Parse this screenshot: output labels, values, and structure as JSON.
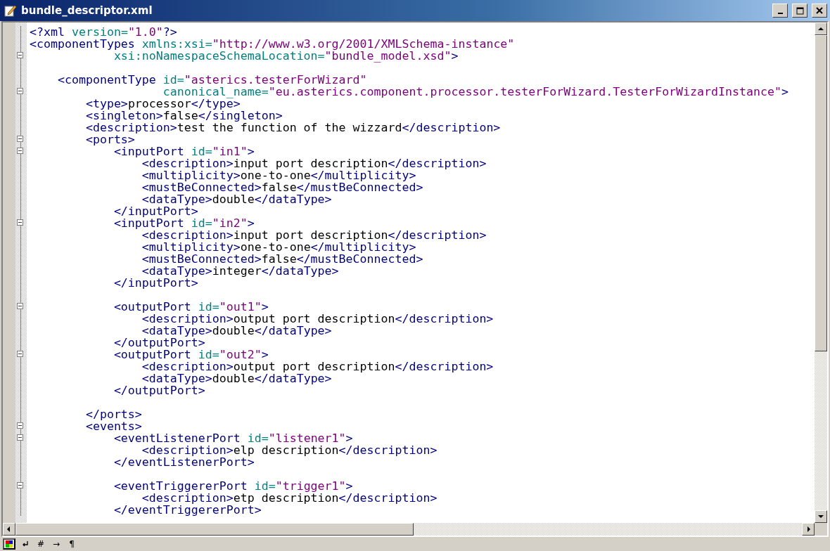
{
  "window": {
    "title": "bundle_descriptor.xml"
  },
  "editor": {
    "lines": [
      {
        "fold": false,
        "tokens": [
          {
            "kind": "tag",
            "text": "<?xml"
          },
          {
            "kind": "attr",
            "text": " version="
          },
          {
            "kind": "value",
            "text": "\"1.0\""
          },
          {
            "kind": "tag",
            "text": "?>"
          }
        ]
      },
      {
        "fold": false,
        "tokens": [
          {
            "kind": "tag",
            "text": "<componentTypes"
          },
          {
            "kind": "attr",
            "text": " xmlns:xsi="
          },
          {
            "kind": "value",
            "text": "\"http://www.w3.org/2001/XMLSchema-instance\""
          }
        ]
      },
      {
        "fold": true,
        "tokens": [
          {
            "kind": "attr",
            "text": "            xsi:noNamespaceSchemaLocation="
          },
          {
            "kind": "value",
            "text": "\"bundle_model.xsd\""
          },
          {
            "kind": "tag",
            "text": ">"
          }
        ]
      },
      {
        "fold": false
      },
      {
        "fold": false,
        "tokens": [
          {
            "kind": "tag",
            "text": "    <componentType"
          },
          {
            "kind": "attr",
            "text": " id="
          },
          {
            "kind": "value",
            "text": "\"asterics.testerForWizard\""
          }
        ]
      },
      {
        "fold": true,
        "tokens": [
          {
            "kind": "attr",
            "text": "                   canonical_name="
          },
          {
            "kind": "value",
            "text": "\"eu.asterics.component.processor.testerForWizard.TesterForWizardInstance\""
          },
          {
            "kind": "tag",
            "text": ">"
          }
        ]
      },
      {
        "fold": false,
        "tokens": [
          {
            "kind": "tag",
            "text": "        <type>"
          },
          {
            "kind": "text",
            "text": "processor"
          },
          {
            "kind": "tag",
            "text": "</type>"
          }
        ]
      },
      {
        "fold": false,
        "tokens": [
          {
            "kind": "tag",
            "text": "        <singleton>"
          },
          {
            "kind": "text",
            "text": "false"
          },
          {
            "kind": "tag",
            "text": "</singleton>"
          }
        ]
      },
      {
        "fold": false,
        "tokens": [
          {
            "kind": "tag",
            "text": "        <description>"
          },
          {
            "kind": "text",
            "text": "test the function of the wizzard"
          },
          {
            "kind": "tag",
            "text": "</description>"
          }
        ]
      },
      {
        "fold": true,
        "tokens": [
          {
            "kind": "tag",
            "text": "        <ports>"
          }
        ]
      },
      {
        "fold": true,
        "tokens": [
          {
            "kind": "tag",
            "text": "            <inputPort"
          },
          {
            "kind": "attr",
            "text": " id="
          },
          {
            "kind": "value",
            "text": "\"in1\""
          },
          {
            "kind": "tag",
            "text": ">"
          }
        ]
      },
      {
        "fold": false,
        "tokens": [
          {
            "kind": "tag",
            "text": "                <description>"
          },
          {
            "kind": "text",
            "text": "input port description"
          },
          {
            "kind": "tag",
            "text": "</description>"
          }
        ]
      },
      {
        "fold": false,
        "tokens": [
          {
            "kind": "tag",
            "text": "                <multiplicity>"
          },
          {
            "kind": "text",
            "text": "one-to-one"
          },
          {
            "kind": "tag",
            "text": "</multiplicity>"
          }
        ]
      },
      {
        "fold": false,
        "tokens": [
          {
            "kind": "tag",
            "text": "                <mustBeConnected>"
          },
          {
            "kind": "text",
            "text": "false"
          },
          {
            "kind": "tag",
            "text": "</mustBeConnected>"
          }
        ]
      },
      {
        "fold": false,
        "tokens": [
          {
            "kind": "tag",
            "text": "                <dataType>"
          },
          {
            "kind": "text",
            "text": "double"
          },
          {
            "kind": "tag",
            "text": "</dataType>"
          }
        ]
      },
      {
        "fold": false,
        "tokens": [
          {
            "kind": "tag",
            "text": "            </inputPort>"
          }
        ]
      },
      {
        "fold": true,
        "tokens": [
          {
            "kind": "tag",
            "text": "            <inputPort"
          },
          {
            "kind": "attr",
            "text": " id="
          },
          {
            "kind": "value",
            "text": "\"in2\""
          },
          {
            "kind": "tag",
            "text": ">"
          }
        ]
      },
      {
        "fold": false,
        "tokens": [
          {
            "kind": "tag",
            "text": "                <description>"
          },
          {
            "kind": "text",
            "text": "input port description"
          },
          {
            "kind": "tag",
            "text": "</description>"
          }
        ]
      },
      {
        "fold": false,
        "tokens": [
          {
            "kind": "tag",
            "text": "                <multiplicity>"
          },
          {
            "kind": "text",
            "text": "one-to-one"
          },
          {
            "kind": "tag",
            "text": "</multiplicity>"
          }
        ]
      },
      {
        "fold": false,
        "tokens": [
          {
            "kind": "tag",
            "text": "                <mustBeConnected>"
          },
          {
            "kind": "text",
            "text": "false"
          },
          {
            "kind": "tag",
            "text": "</mustBeConnected>"
          }
        ]
      },
      {
        "fold": false,
        "tokens": [
          {
            "kind": "tag",
            "text": "                <dataType>"
          },
          {
            "kind": "text",
            "text": "integer"
          },
          {
            "kind": "tag",
            "text": "</dataType>"
          }
        ]
      },
      {
        "fold": false,
        "tokens": [
          {
            "kind": "tag",
            "text": "            </inputPort>"
          }
        ]
      },
      {
        "fold": false
      },
      {
        "fold": true,
        "tokens": [
          {
            "kind": "tag",
            "text": "            <outputPort"
          },
          {
            "kind": "attr",
            "text": " id="
          },
          {
            "kind": "value",
            "text": "\"out1\""
          },
          {
            "kind": "tag",
            "text": ">"
          }
        ]
      },
      {
        "fold": false,
        "tokens": [
          {
            "kind": "tag",
            "text": "                <description>"
          },
          {
            "kind": "text",
            "text": "output port description"
          },
          {
            "kind": "tag",
            "text": "</description>"
          }
        ]
      },
      {
        "fold": false,
        "tokens": [
          {
            "kind": "tag",
            "text": "                <dataType>"
          },
          {
            "kind": "text",
            "text": "double"
          },
          {
            "kind": "tag",
            "text": "</dataType>"
          }
        ]
      },
      {
        "fold": false,
        "tokens": [
          {
            "kind": "tag",
            "text": "            </outputPort>"
          }
        ]
      },
      {
        "fold": true,
        "tokens": [
          {
            "kind": "tag",
            "text": "            <outputPort"
          },
          {
            "kind": "attr",
            "text": " id="
          },
          {
            "kind": "value",
            "text": "\"out2\""
          },
          {
            "kind": "tag",
            "text": ">"
          }
        ]
      },
      {
        "fold": false,
        "tokens": [
          {
            "kind": "tag",
            "text": "                <description>"
          },
          {
            "kind": "text",
            "text": "output port description"
          },
          {
            "kind": "tag",
            "text": "</description>"
          }
        ]
      },
      {
        "fold": false,
        "tokens": [
          {
            "kind": "tag",
            "text": "                <dataType>"
          },
          {
            "kind": "text",
            "text": "double"
          },
          {
            "kind": "tag",
            "text": "</dataType>"
          }
        ]
      },
      {
        "fold": false,
        "tokens": [
          {
            "kind": "tag",
            "text": "            </outputPort>"
          }
        ]
      },
      {
        "fold": false
      },
      {
        "fold": false,
        "tokens": [
          {
            "kind": "tag",
            "text": "        </ports>"
          }
        ]
      },
      {
        "fold": true,
        "tokens": [
          {
            "kind": "tag",
            "text": "        <events>"
          }
        ]
      },
      {
        "fold": true,
        "tokens": [
          {
            "kind": "tag",
            "text": "            <eventListenerPort"
          },
          {
            "kind": "attr",
            "text": " id="
          },
          {
            "kind": "value",
            "text": "\"listener1\""
          },
          {
            "kind": "tag",
            "text": ">"
          }
        ]
      },
      {
        "fold": false,
        "tokens": [
          {
            "kind": "tag",
            "text": "                <description>"
          },
          {
            "kind": "text",
            "text": "elp description"
          },
          {
            "kind": "tag",
            "text": "</description>"
          }
        ]
      },
      {
        "fold": false,
        "tokens": [
          {
            "kind": "tag",
            "text": "            </eventListenerPort>"
          }
        ]
      },
      {
        "fold": false
      },
      {
        "fold": true,
        "tokens": [
          {
            "kind": "tag",
            "text": "            <eventTriggererPort"
          },
          {
            "kind": "attr",
            "text": " id="
          },
          {
            "kind": "value",
            "text": "\"trigger1\""
          },
          {
            "kind": "tag",
            "text": ">"
          }
        ]
      },
      {
        "fold": false,
        "tokens": [
          {
            "kind": "tag",
            "text": "                <description>"
          },
          {
            "kind": "text",
            "text": "etp description"
          },
          {
            "kind": "tag",
            "text": "</description>"
          }
        ]
      },
      {
        "fold": false,
        "tokens": [
          {
            "kind": "tag",
            "text": "            </eventTriggererPort>"
          }
        ]
      }
    ]
  },
  "status_bar": {
    "buttons": [
      {
        "kind": "colors",
        "selected": true
      },
      {
        "kind": "wrap",
        "selected": false
      },
      {
        "kind": "text",
        "text": "#",
        "selected": false
      },
      {
        "kind": "text",
        "text": "→",
        "selected": false
      },
      {
        "kind": "text",
        "text": "¶",
        "selected": false
      }
    ]
  }
}
